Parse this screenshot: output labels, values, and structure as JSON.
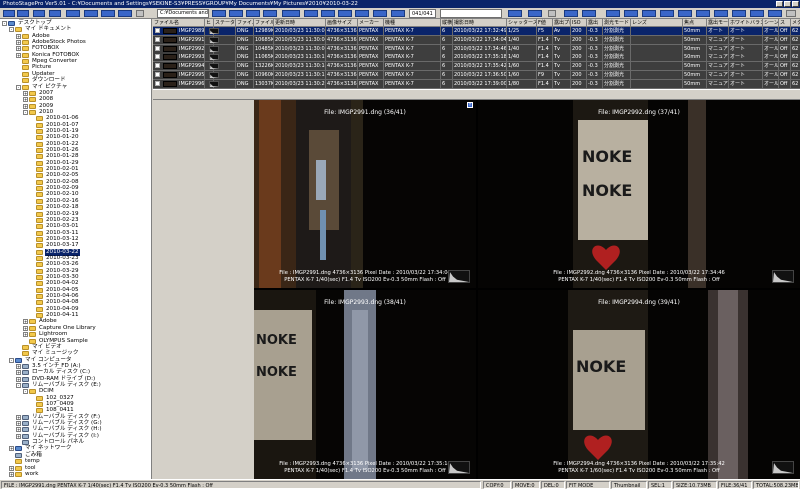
{
  "window": {
    "title": "PhotoStagePro Ver5.01 - C:¥Documents and Settings¥SEKINE-S3¥PRESS¥GROUP¥My Documents¥My Pictures¥2010¥2010-03-22"
  },
  "toolbar": {
    "path_combo": "C:¥Documents and Se",
    "count": "041/041"
  },
  "tree": [
    {
      "label": "デスクトップ",
      "indent": 0,
      "exp": "-",
      "kind": "pc"
    },
    {
      "label": "マイ ドキュメント",
      "indent": 1,
      "exp": "-",
      "kind": "folder"
    },
    {
      "label": "Adobe",
      "indent": 2,
      "exp": "+",
      "kind": "folder"
    },
    {
      "label": "AdobeStock Photos",
      "indent": 2,
      "exp": "+",
      "kind": "folder"
    },
    {
      "label": "FOTOBOX",
      "indent": 2,
      "exp": "+",
      "kind": "folder"
    },
    {
      "label": "Konica FOTOBOX",
      "indent": 2,
      "exp": "+",
      "kind": "folder"
    },
    {
      "label": "Mpeg Converter",
      "indent": 2,
      "exp": "",
      "kind": "folder"
    },
    {
      "label": "Picture",
      "indent": 2,
      "exp": "",
      "kind": "folder"
    },
    {
      "label": "Updater",
      "indent": 2,
      "exp": "",
      "kind": "folder"
    },
    {
      "label": "ダウンロード",
      "indent": 2,
      "exp": "",
      "kind": "folder"
    },
    {
      "label": "マイ ピクチャ",
      "indent": 2,
      "exp": "-",
      "kind": "folder"
    },
    {
      "label": "2007",
      "indent": 3,
      "exp": "+",
      "kind": "folder"
    },
    {
      "label": "2008",
      "indent": 3,
      "exp": "+",
      "kind": "folder"
    },
    {
      "label": "2009",
      "indent": 3,
      "exp": "+",
      "kind": "folder"
    },
    {
      "label": "2010",
      "indent": 3,
      "exp": "-",
      "kind": "folder"
    },
    {
      "label": "2010-01-06",
      "indent": 4,
      "exp": "",
      "kind": "folder"
    },
    {
      "label": "2010-01-07",
      "indent": 4,
      "exp": "",
      "kind": "folder"
    },
    {
      "label": "2010-01-19",
      "indent": 4,
      "exp": "",
      "kind": "folder"
    },
    {
      "label": "2010-01-20",
      "indent": 4,
      "exp": "",
      "kind": "folder"
    },
    {
      "label": "2010-01-22",
      "indent": 4,
      "exp": "",
      "kind": "folder"
    },
    {
      "label": "2010-01-26",
      "indent": 4,
      "exp": "",
      "kind": "folder"
    },
    {
      "label": "2010-01-28",
      "indent": 4,
      "exp": "",
      "kind": "folder"
    },
    {
      "label": "2010-01-29",
      "indent": 4,
      "exp": "",
      "kind": "folder"
    },
    {
      "label": "2010-02-01",
      "indent": 4,
      "exp": "",
      "kind": "folder"
    },
    {
      "label": "2010-02-05",
      "indent": 4,
      "exp": "",
      "kind": "folder"
    },
    {
      "label": "2010-02-08",
      "indent": 4,
      "exp": "",
      "kind": "folder"
    },
    {
      "label": "2010-02-09",
      "indent": 4,
      "exp": "",
      "kind": "folder"
    },
    {
      "label": "2010-02-10",
      "indent": 4,
      "exp": "",
      "kind": "folder"
    },
    {
      "label": "2010-02-16",
      "indent": 4,
      "exp": "",
      "kind": "folder"
    },
    {
      "label": "2010-02-18",
      "indent": 4,
      "exp": "",
      "kind": "folder"
    },
    {
      "label": "2010-02-19",
      "indent": 4,
      "exp": "",
      "kind": "folder"
    },
    {
      "label": "2010-02-23",
      "indent": 4,
      "exp": "",
      "kind": "folder"
    },
    {
      "label": "2010-03-01",
      "indent": 4,
      "exp": "",
      "kind": "folder"
    },
    {
      "label": "2010-03-11",
      "indent": 4,
      "exp": "",
      "kind": "folder"
    },
    {
      "label": "2010-03-12",
      "indent": 4,
      "exp": "",
      "kind": "folder"
    },
    {
      "label": "2010-03-17",
      "indent": 4,
      "exp": "",
      "kind": "folder"
    },
    {
      "label": "2010-03-22",
      "indent": 4,
      "exp": "",
      "kind": "folder",
      "selected": true
    },
    {
      "label": "2010-03-23",
      "indent": 4,
      "exp": "",
      "kind": "folder"
    },
    {
      "label": "2010-03-26",
      "indent": 4,
      "exp": "",
      "kind": "folder"
    },
    {
      "label": "2010-03-29",
      "indent": 4,
      "exp": "",
      "kind": "folder"
    },
    {
      "label": "2010-03-30",
      "indent": 4,
      "exp": "",
      "kind": "folder"
    },
    {
      "label": "2010-04-02",
      "indent": 4,
      "exp": "",
      "kind": "folder"
    },
    {
      "label": "2010-04-05",
      "indent": 4,
      "exp": "",
      "kind": "folder"
    },
    {
      "label": "2010-04-06",
      "indent": 4,
      "exp": "",
      "kind": "folder"
    },
    {
      "label": "2010-04-08",
      "indent": 4,
      "exp": "",
      "kind": "folder"
    },
    {
      "label": "2010-04-09",
      "indent": 4,
      "exp": "",
      "kind": "folder"
    },
    {
      "label": "2010-04-11",
      "indent": 4,
      "exp": "",
      "kind": "folder"
    },
    {
      "label": "Adobe",
      "indent": 3,
      "exp": "+",
      "kind": "folder"
    },
    {
      "label": "Capture One Library",
      "indent": 3,
      "exp": "+",
      "kind": "folder"
    },
    {
      "label": "Lightroom",
      "indent": 3,
      "exp": "+",
      "kind": "folder"
    },
    {
      "label": "OLYMPUS Sample",
      "indent": 3,
      "exp": "",
      "kind": "folder"
    },
    {
      "label": "マイ ビデオ",
      "indent": 2,
      "exp": "",
      "kind": "folder"
    },
    {
      "label": "マイ ミュージック",
      "indent": 2,
      "exp": "",
      "kind": "folder"
    },
    {
      "label": "マイ コンピュータ",
      "indent": 1,
      "exp": "-",
      "kind": "pc"
    },
    {
      "label": "3.5 インチ FD (A:)",
      "indent": 2,
      "exp": "+",
      "kind": "dev"
    },
    {
      "label": "ローカル ディスク (C:)",
      "indent": 2,
      "exp": "+",
      "kind": "dev"
    },
    {
      "label": "DVD-RAM ドライブ (D:)",
      "indent": 2,
      "exp": "+",
      "kind": "dev"
    },
    {
      "label": "リムーバブル ディスク (E:)",
      "indent": 2,
      "exp": "-",
      "kind": "dev"
    },
    {
      "label": "DCIM",
      "indent": 3,
      "exp": "-",
      "kind": "folder"
    },
    {
      "label": "102_0327",
      "indent": 4,
      "exp": "",
      "kind": "folder"
    },
    {
      "label": "107_0409",
      "indent": 4,
      "exp": "",
      "kind": "folder"
    },
    {
      "label": "108_0411",
      "indent": 4,
      "exp": "",
      "kind": "folder"
    },
    {
      "label": "リムーバブル ディスク (F:)",
      "indent": 2,
      "exp": "+",
      "kind": "dev"
    },
    {
      "label": "リムーバブル ディスク (G:)",
      "indent": 2,
      "exp": "+",
      "kind": "dev"
    },
    {
      "label": "リムーバブル ディスク (H:)",
      "indent": 2,
      "exp": "+",
      "kind": "dev"
    },
    {
      "label": "リムーバブル ディスク (I:)",
      "indent": 2,
      "exp": "+",
      "kind": "dev"
    },
    {
      "label": "コントロール パネル",
      "indent": 2,
      "exp": "",
      "kind": "dev"
    },
    {
      "label": "マイ ネットワーク",
      "indent": 1,
      "exp": "+",
      "kind": "pc"
    },
    {
      "label": "ごみ箱",
      "indent": 1,
      "exp": "",
      "kind": "dev"
    },
    {
      "label": "temp",
      "indent": 1,
      "exp": "",
      "kind": "folder"
    },
    {
      "label": "tool",
      "indent": 1,
      "exp": "+",
      "kind": "folder"
    },
    {
      "label": "work",
      "indent": 1,
      "exp": "+",
      "kind": "folder"
    }
  ],
  "table": {
    "columns": [
      "ファイル名",
      "ヒ",
      "ステータ",
      "ファイル形",
      "ファイルサ",
      "更新日時",
      "画像サイズ",
      "メーカー",
      "機種",
      "縦横",
      "撮影日時",
      "シャッタースピード",
      "F値",
      "露出プロ",
      "ISO",
      "露出",
      "測光モード",
      "レンズ",
      "焦点",
      "露出モー",
      "ホワイトバランス",
      "シーン",
      "ス",
      "メタリング"
    ],
    "rows": [
      {
        "sel": true,
        "cells": [
          "IMGP2989.dng",
          "",
          "",
          "DNG",
          "12989KB",
          "2010/03/23 11:30:02",
          "4736×3136",
          "PENTAX",
          "PENTAX K-7",
          "6",
          "2010/03/22 17:32:49",
          "1/25",
          "F5",
          "Av",
          "200",
          "-0.3",
          "分割測光",
          "",
          "50mm",
          "オート",
          "オート",
          "オール",
          "Off",
          "62"
        ]
      },
      {
        "sel": false,
        "cells": [
          "IMGP2991.dng",
          "",
          "",
          "DNG",
          "10685KB",
          "2010/03/23 11:30:04",
          "4736×3136",
          "PENTAX",
          "PENTAX K-7",
          "6",
          "2010/03/22 17:34:04",
          "1/40",
          "F1.4",
          "Tv",
          "200",
          "-0.3",
          "分割測光",
          "",
          "50mm",
          "マニュアル",
          "オート",
          "オール",
          "Off",
          "62"
        ]
      },
      {
        "sel": false,
        "cells": [
          "IMGP2992.dng",
          "",
          "",
          "DNG",
          "10485KB",
          "2010/03/23 11:30:08",
          "4736×3136",
          "PENTAX",
          "PENTAX K-7",
          "6",
          "2010/03/22 17:34:46",
          "1/40",
          "F1.4",
          "Tv",
          "200",
          "-0.3",
          "分割測光",
          "",
          "50mm",
          "マニュアル",
          "オート",
          "オール",
          "Off",
          "62"
        ]
      },
      {
        "sel": false,
        "cells": [
          "IMGP2993.dng",
          "",
          "",
          "DNG",
          "11065KB",
          "2010/03/23 11:30:12",
          "4736×3136",
          "PENTAX",
          "PENTAX K-7",
          "6",
          "2010/03/22 17:35:18",
          "1/40",
          "F1.4",
          "Tv",
          "200",
          "-0.3",
          "分割測光",
          "",
          "50mm",
          "マニュアル",
          "オート",
          "オール",
          "Off",
          "62"
        ]
      },
      {
        "sel": false,
        "cells": [
          "IMGP2994.dng",
          "",
          "",
          "DNG",
          "13226KB",
          "2010/03/23 11:30:14",
          "4736×3136",
          "PENTAX",
          "PENTAX K-7",
          "6",
          "2010/03/22 17:35:42",
          "1/60",
          "F1.4",
          "Tv",
          "200",
          "-0.3",
          "分割測光",
          "",
          "50mm",
          "マニュアル",
          "オート",
          "オール",
          "Off",
          "62"
        ]
      },
      {
        "sel": false,
        "cells": [
          "IMGP2995.dng",
          "",
          "",
          "DNG",
          "10960KB",
          "2010/03/23 11:30:18",
          "4736×3136",
          "PENTAX",
          "PENTAX K-7",
          "6",
          "2010/03/22 17:36:50",
          "1/60",
          "F9",
          "Tv",
          "200",
          "-0.3",
          "分割測光",
          "",
          "50mm",
          "マニュアル",
          "オート",
          "オール",
          "Off",
          "62"
        ]
      },
      {
        "sel": false,
        "cells": [
          "IMGP2996.dng",
          "",
          "",
          "DNG",
          "13037KB",
          "2010/03/23 11:30:20",
          "4736×3136",
          "PENTAX",
          "PENTAX K-7",
          "6",
          "2010/03/22 17:39:00",
          "1/80",
          "F1.4",
          "Tv",
          "200",
          "-0.3",
          "分割測光",
          "",
          "50mm",
          "マニュアル",
          "オート",
          "オール",
          "Off",
          "62"
        ]
      }
    ]
  },
  "viewer": {
    "panes": [
      {
        "fname": "File: IMGP2991.dng  (36/41)",
        "info1": "File : IMGP2991.dng  4736×3136 Pixel  Date : 2010/03/22 17:34:04",
        "info2": "PENTAX K-7  1/40(sec)  F1.4  Tv  ISO200  Ev-0.3  50mm  Flash : Off"
      },
      {
        "fname": "File: IMGP2992.dng  (37/41)",
        "info1": "File : IMGP2992.dng  4736×3136 Pixel  Date : 2010/03/22 17:34:46",
        "info2": "PENTAX K-7  1/40(sec)  F1.4  Tv  ISO200  Ev-0.3  50mm  Flash : Off"
      },
      {
        "fname": "File: IMGP2993.dng  (38/41)",
        "info1": "File : IMGP2993.dng  4736×3136 Pixel  Date : 2010/03/22 17:35:18",
        "info2": "PENTAX K-7  1/40(sec)  F1.4  Tv  ISO200  Ev-0.3  50mm  Flash : Off"
      },
      {
        "fname": "File: IMGP2994.dng  (39/41)",
        "info1": "File : IMGP2994.dng  4736×3136 Pixel  Date : 2010/03/22 17:35:42",
        "info2": "PENTAX K-7  1/60(sec)  F1.4  Tv  ISO200  Ev-0.3  50mm  Flash : Off"
      }
    ],
    "flag": "Y"
  },
  "statusbar": {
    "file": "FILE : IMGP2991.dng   PENTAX K-7 1/40(sec)  F1.4  Tv  ISO200  Ev-0.3  50mm   Flash : Off",
    "copy": "COPY:0",
    "move": "MOVE:0",
    "del": "DEL:0",
    "fitmode": "FIT MODE",
    "thumbnail": "Thumbnail",
    "sel": "SEL:1",
    "size": "SIZE:10.73MB",
    "files": "FILE:36/41",
    "total": "TOTAL:508.23MB"
  }
}
